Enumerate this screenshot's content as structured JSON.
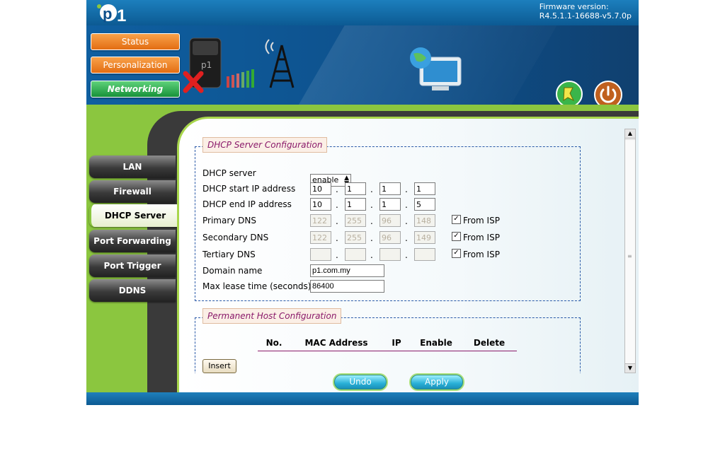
{
  "header": {
    "firmware_label": "Firmware version:",
    "firmware_value": "R4.5.1.1-16688-v5.7.0p",
    "logo_text": "p1"
  },
  "top_menu": {
    "status": "Status",
    "personalization": "Personalization",
    "networking": "Networking"
  },
  "sidebar": {
    "items": [
      {
        "label": "LAN"
      },
      {
        "label": "Firewall"
      },
      {
        "label": "DHCP Server"
      },
      {
        "label": "Port Forwarding"
      },
      {
        "label": "Port Trigger"
      },
      {
        "label": "DDNS"
      }
    ],
    "active": "DHCP Server"
  },
  "dhcp": {
    "title": "DHCP Server Configuration",
    "server_label": "DHCP server",
    "server_value": "enable",
    "start_label": "DHCP start IP address",
    "start_ip": [
      "10",
      "1",
      "1",
      "1"
    ],
    "end_label": "DHCP end IP address",
    "end_ip": [
      "10",
      "1",
      "1",
      "5"
    ],
    "primary_label": "Primary DNS",
    "primary_dns": [
      "122",
      "255",
      "96",
      "148"
    ],
    "secondary_label": "Secondary DNS",
    "secondary_dns": [
      "122",
      "255",
      "96",
      "149"
    ],
    "tertiary_label": "Tertiary DNS",
    "tertiary_dns": [
      "",
      "",
      "",
      ""
    ],
    "from_isp": "From ISP",
    "domain_label": "Domain name",
    "domain_value": "p1.com.my",
    "lease_label": "Max lease time (seconds)",
    "lease_value": "86400"
  },
  "permanent": {
    "title": "Permanent Host Configuration",
    "columns": [
      "No.",
      "MAC Address",
      "IP",
      "Enable",
      "Delete"
    ],
    "insert_label": "Insert"
  },
  "actions": {
    "undo": "Undo",
    "apply": "Apply"
  },
  "colors": {
    "accent_green": "#8bc63f",
    "header_blue": "#0d4f8a",
    "legend_text": "#8a1a6a"
  }
}
